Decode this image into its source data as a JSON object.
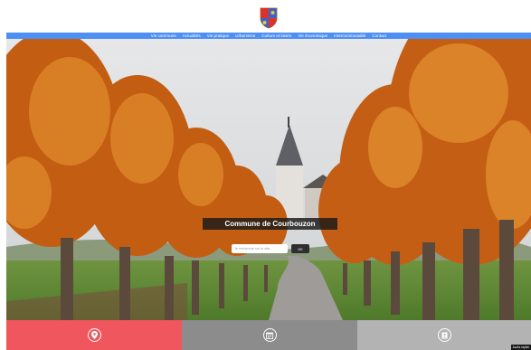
{
  "logo": {
    "icon": "coat-of-arms-icon"
  },
  "nav": {
    "items": [
      {
        "label": "Vie commune"
      },
      {
        "label": "Actualités"
      },
      {
        "label": "Vie pratique"
      },
      {
        "label": "Urbanisme"
      },
      {
        "label": "Culture et loisirs"
      },
      {
        "label": "Vie économique"
      },
      {
        "label": "Intercommunalité"
      },
      {
        "label": "Contact"
      }
    ]
  },
  "hero": {
    "title": "Commune de Courbouzon",
    "search": {
      "placeholder": "Je recherche sur le site...",
      "button_label": "OK"
    }
  },
  "tiles": [
    {
      "icon": "map-pin-icon",
      "color": "#f0565d"
    },
    {
      "icon": "calendar-icon",
      "color": "#8c8c8c"
    },
    {
      "icon": "contact-book-icon",
      "color": "#b3b3b3"
    }
  ],
  "footer": {
    "corner_link": "Accès rapide"
  },
  "colors": {
    "nav": "#4d8ff2",
    "tile_red": "#f0565d",
    "tile_gray": "#8c8c8c",
    "tile_light": "#b3b3b3"
  }
}
